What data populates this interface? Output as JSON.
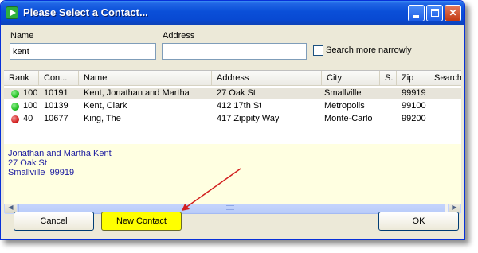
{
  "window": {
    "title": "Please Select a Contact..."
  },
  "search": {
    "name_label": "Name",
    "name_value": "kent",
    "address_label": "Address",
    "address_value": "",
    "narrow_label": "Search more narrowly",
    "narrow_checked": false
  },
  "table": {
    "columns": [
      "Rank",
      "Con...",
      "Name",
      "Address",
      "City",
      "S.",
      "Zip",
      "Search"
    ],
    "rows": [
      {
        "status": "green",
        "rank": "100",
        "contact": "10191",
        "name": "Kent, Jonathan and Martha",
        "address": "27 Oak St",
        "city": "Smallville",
        "state": "",
        "zip": "99919",
        "selected": true
      },
      {
        "status": "green",
        "rank": "100",
        "contact": "10139",
        "name": "Kent, Clark",
        "address": "412 17th St",
        "city": "Metropolis",
        "state": "",
        "zip": "99100",
        "selected": false
      },
      {
        "status": "red",
        "rank": "40",
        "contact": "10677",
        "name": "King, The",
        "address": "417 Zippity Way",
        "city": "Monte-Carlo",
        "state": "",
        "zip": "99200",
        "selected": false
      }
    ]
  },
  "details": {
    "line1": "Jonathan and Martha Kent",
    "line2": "27 Oak St",
    "line3": "Smallville  99919"
  },
  "buttons": {
    "cancel": "Cancel",
    "new_contact": "New Contact",
    "ok": "OK"
  },
  "colors": {
    "status_green": "#22c022",
    "status_red": "#d42020",
    "highlight": "#ffff00",
    "annotation_arrow": "#d21f1f"
  }
}
